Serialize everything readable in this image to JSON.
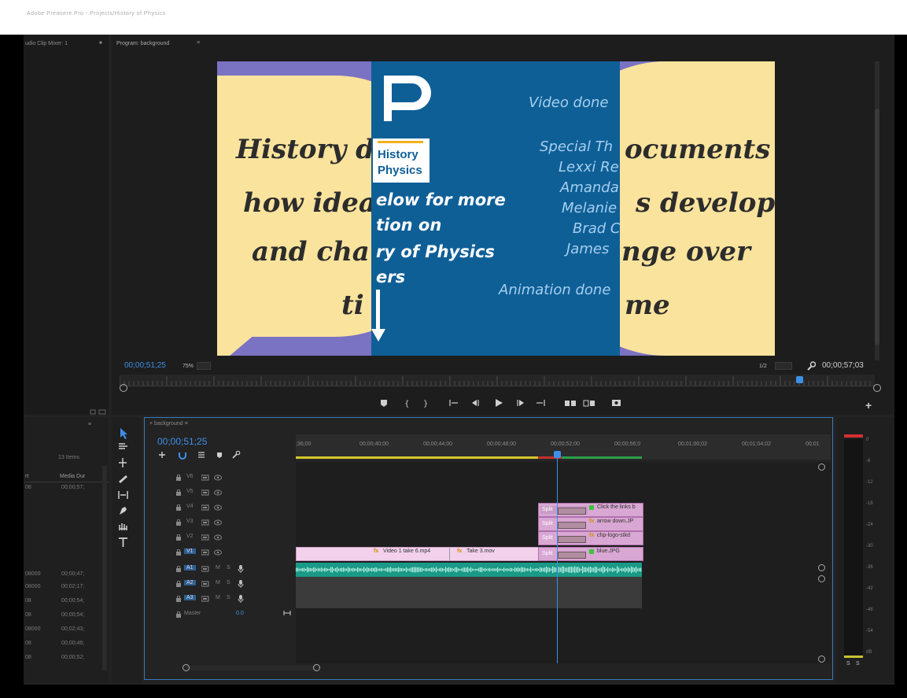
{
  "titlebar": {
    "title": "Adobe Premiere Pro - Projects/History of Physics"
  },
  "left_panel": {
    "tab_label": "udio Clip Mixer: 1",
    "overflow": "»"
  },
  "program_monitor": {
    "tab_label": "Program: background",
    "menu_icon": "≡",
    "timecode_current": "00;00;51;25",
    "zoom": "75%",
    "resolution": "1/2",
    "timecode_duration": "00;00;57;03",
    "playhead_fraction": 0.9
  },
  "video": {
    "line1a": "History d",
    "line1b": "ocuments",
    "line2a": "how idea",
    "line2b": "s develop",
    "line3a": "and cha",
    "line3b": "nge over",
    "line4a": "ti",
    "line4b": "me",
    "logo_text1": "History",
    "logo_text2": "Physics",
    "promo1": "elow for more",
    "promo2": "tion on",
    "promo3": "ry of Physics",
    "promo4": "ers",
    "credits_title": "Video done",
    "credits_special": "Special Th",
    "credits_names": [
      "Lexxi Re",
      "Amanda",
      "Melanie",
      "Brad C",
      "James"
    ],
    "credits_animation": "Animation done"
  },
  "project_panel": {
    "menu_icon": "≡",
    "items_count": "13 Items",
    "col1": "rt",
    "col2": "Media Dur",
    "rows": [
      {
        "a": "08",
        "b": "00;00;57;"
      },
      {
        "a": "08000",
        "b": "00;00;47;"
      },
      {
        "a": "08000",
        "b": "00;02;17;"
      },
      {
        "a": "08",
        "b": "00;00;54;"
      },
      {
        "a": "08",
        "b": "00;00;54;"
      },
      {
        "a": "08000",
        "b": "00;02;43;"
      },
      {
        "a": "08",
        "b": "00;00;46;"
      },
      {
        "a": "08",
        "b": "00;00;52;"
      }
    ]
  },
  "timeline": {
    "tab_label": "background",
    "menu_icon": "≡",
    "timecode": "00;00;51;25",
    "ruler_labels": [
      ";36;00",
      "00;00;40;00",
      "00;00;44;00",
      "00;00;48;00",
      "00;00;52;00",
      "00;00;56;0",
      "00;01;00;02",
      "00;01;04;02",
      "00;01"
    ],
    "video_tracks": [
      "V6",
      "V5",
      "V4",
      "V3",
      "V2",
      "V1"
    ],
    "audio_tracks": [
      "A1",
      "A2",
      "A3"
    ],
    "audio_m": "M",
    "audio_s": "S",
    "master_label": "Master",
    "master_value": "0.0",
    "split_label": "Split",
    "clips": {
      "v4_title": "Click the links b",
      "v3_title": "arrow down.JP",
      "v2_title": "chp-logo-stkd",
      "v1_title": "blue.JPG",
      "v1_clip1": "Video 1 take 6.mp4",
      "v1_clip2": "Take 3.mov",
      "fx_mark": "fx"
    }
  },
  "meters": {
    "scale": [
      "0",
      "-6",
      "-12",
      "-18",
      "-24",
      "-30",
      "-36",
      "-42",
      "-48",
      "-54",
      "dB"
    ],
    "solo_left": "S",
    "solo_right": "S"
  },
  "colors": {
    "accent_blue": "#3d8fe8",
    "video_purple": "#7a72c2",
    "video_yellow": "#fae39c",
    "video_blue": "#0f5f97",
    "clip_pink": "#d9a7d3",
    "audio_green": "#1a9a86"
  }
}
